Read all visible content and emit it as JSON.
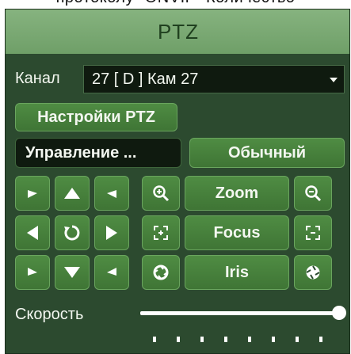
{
  "caption": {
    "text": "протоколу \"ONVIF\" Количество"
  },
  "window": {
    "title": "PTZ"
  },
  "channel": {
    "label": "Канал",
    "value": "27 [ D ] Кам 27"
  },
  "settings": {
    "button": "Настройки PTZ"
  },
  "control": {
    "mode_button": "Управление ...",
    "mode_value": "Обычный"
  },
  "zoom": {
    "label": "Zoom"
  },
  "focus": {
    "label": "Focus"
  },
  "iris": {
    "label": "Iris"
  },
  "speed": {
    "label": "Скорость",
    "value": 1.0
  },
  "icons": [
    "arrow-up-left-icon",
    "arrow-up-icon",
    "arrow-up-right-icon",
    "arrow-left-icon",
    "rotate-icon",
    "arrow-right-icon",
    "arrow-down-left-icon",
    "arrow-down-icon",
    "arrow-down-right-icon",
    "zoom-in-icon",
    "zoom-out-icon",
    "focus-near-icon",
    "focus-far-icon",
    "iris-open-icon",
    "iris-close-icon"
  ]
}
